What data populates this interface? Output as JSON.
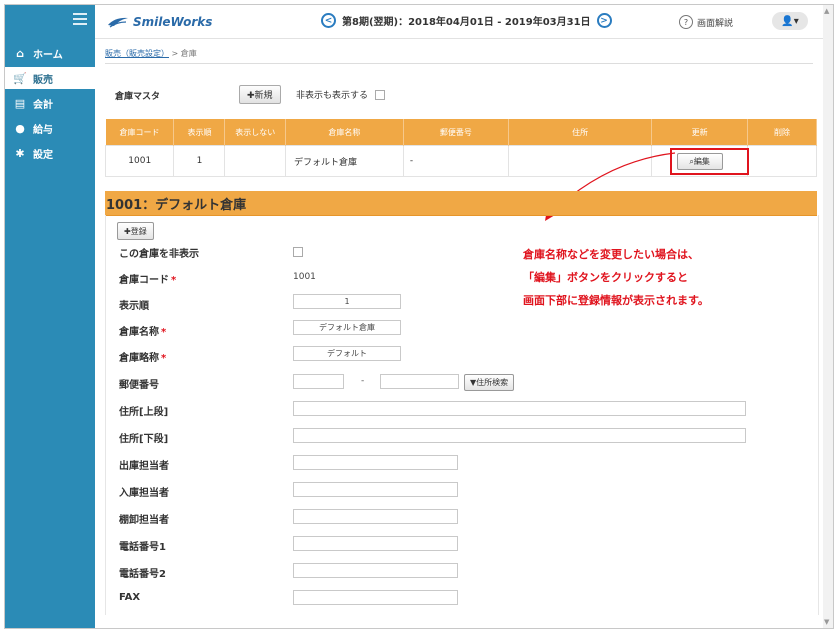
{
  "header": {
    "logo_text": "SmileWorks",
    "period_text": "第8期(翌期)：2018年04月01日 - 2019年03月31日",
    "prev_symbol": "<",
    "next_symbol": ">",
    "help_icon_char": "?",
    "help_label": "画面解説",
    "user_icon": "user-icon",
    "user_label": "👤▾"
  },
  "sidebar": {
    "items": [
      {
        "label": "ホーム",
        "icon": "home-icon",
        "glyph": "⌂",
        "active": false
      },
      {
        "label": "販売",
        "icon": "cart-icon",
        "glyph": "🛒",
        "active": true
      },
      {
        "label": "会計",
        "icon": "ledger-icon",
        "glyph": "▤",
        "active": false
      },
      {
        "label": "給与",
        "icon": "money-bag-icon",
        "glyph": "●",
        "active": false
      },
      {
        "label": "設定",
        "icon": "gear-icon",
        "glyph": "✱",
        "active": false
      }
    ]
  },
  "breadcrumb": {
    "link": "販売（販売設定）",
    "separator": ">",
    "current": "倉庫"
  },
  "master": {
    "label": "倉庫マスタ",
    "new_button": "✚新規",
    "show_hidden_label": "非表示も表示する"
  },
  "table": {
    "headers": [
      "倉庫コード",
      "表示順",
      "表示しない",
      "倉庫名称",
      "郵便番号",
      "住所",
      "更新",
      "削除"
    ],
    "rows": [
      {
        "code": "1001",
        "order": "1",
        "hidden": "",
        "name": "デフォルト倉庫",
        "zip": "-",
        "address": "",
        "edit_label": "⌕編集",
        "delete": ""
      }
    ]
  },
  "detail": {
    "title": "1001：デフォルト倉庫",
    "register_button": "✚登録",
    "fields": {
      "hide_label": "この倉庫を非表示",
      "code_label": "倉庫コード",
      "code_value": "1001",
      "order_label": "表示順",
      "order_value": "1",
      "name_label": "倉庫名称",
      "name_value": "デフォルト倉庫",
      "short_label": "倉庫略称",
      "short_value": "デフォルト",
      "zip_label": "郵便番号",
      "zip_dash": "-",
      "zip_search": "▼住所検索",
      "addr1_label": "住所[上段]",
      "addr2_label": "住所[下段]",
      "out_label": "出庫担当者",
      "in_label": "入庫担当者",
      "stock_label": "棚卸担当者",
      "tel1_label": "電話番号1",
      "tel2_label": "電話番号2",
      "fax_label": "FAX",
      "required_mark": "*"
    }
  },
  "annotation": {
    "line1": "倉庫名称などを変更したい場合は、",
    "line2": "「編集」ボタンをクリックすると",
    "line3": "画面下部に登録情報が表示されます。"
  },
  "colors": {
    "sidebar": "#2b8bb6",
    "accent_orange": "#f0a845",
    "annotation_red": "#e0141e",
    "link_blue": "#2a6aa8"
  }
}
